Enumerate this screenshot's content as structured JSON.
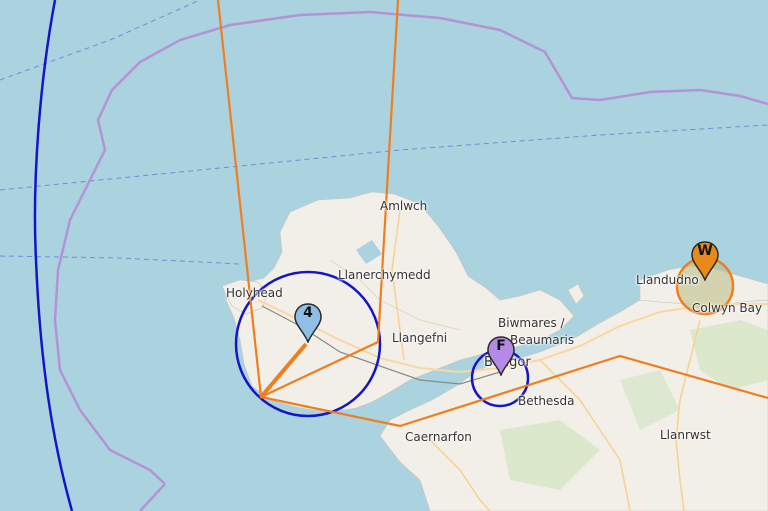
{
  "map": {
    "place_labels": {
      "amlwch": "Amlwch",
      "holyhead": "Holyhead",
      "llanerchymedd": "Llanerchymedd",
      "llangefni": "Llangefni",
      "biwmares": "Biwmares /",
      "beaumaris": "Beaumaris",
      "bangor": "Bangor",
      "bethesda": "Bethesda",
      "caernarfon": "Caernarfon",
      "llandudno": "Llandudno",
      "colwyn_bay": "Colwyn Bay",
      "llanrwst": "Llanrwst"
    },
    "markers": {
      "site_4": {
        "label": "4",
        "color": "#8fbfe6"
      },
      "site_f": {
        "label": "F",
        "color": "#b58ae6"
      },
      "site_w": {
        "label": "W",
        "color": "#e8891a"
      }
    },
    "colors": {
      "sea": "#aad3df",
      "land": "#f2efe9",
      "boundary": "#b492d6",
      "coverage_lines": "#f07d1e",
      "range_circles": "#1515c8"
    }
  }
}
